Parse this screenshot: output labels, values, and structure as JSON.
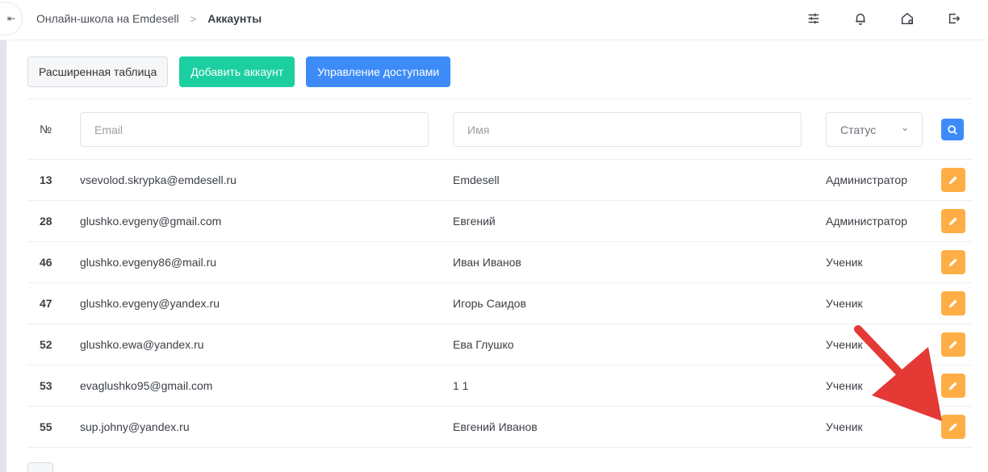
{
  "header": {
    "collapse_glyph": "⇤",
    "breadcrumb": {
      "root": "Онлайн-школа на Emdesell",
      "separator": ">",
      "current": "Аккаунты"
    },
    "icons": [
      "sliders-icon",
      "bell-icon",
      "home-settings-icon",
      "logout-icon"
    ]
  },
  "toolbar": {
    "extended_table_label": "Расширенная таблица",
    "add_account_label": "Добавить аккаунт",
    "access_management_label": "Управление доступами"
  },
  "filters": {
    "num_header": "№",
    "email_placeholder": "Email",
    "name_placeholder": "Имя",
    "status_label": "Статус",
    "status_chevron": "⌄"
  },
  "rows": [
    {
      "id": "13",
      "email": "vsevolod.skrypka@emdesell.ru",
      "name": "Emdesell",
      "status": "Администратор"
    },
    {
      "id": "28",
      "email": "glushko.evgeny@gmail.com",
      "name": "Евгений",
      "status": "Администратор"
    },
    {
      "id": "46",
      "email": "glushko.evgeny86@mail.ru",
      "name": "Иван Иванов",
      "status": "Ученик"
    },
    {
      "id": "47",
      "email": "glushko.evgeny@yandex.ru",
      "name": "Игорь Саидов",
      "status": "Ученик"
    },
    {
      "id": "52",
      "email": "glushko.ewa@yandex.ru",
      "name": "Ева Глушко",
      "status": "Ученик"
    },
    {
      "id": "53",
      "email": "evaglushko95@gmail.com",
      "name": "1 1",
      "status": "Ученик"
    },
    {
      "id": "55",
      "email": "sup.johny@yandex.ru",
      "name": "Евгений Иванов",
      "status": "Ученик"
    }
  ],
  "colors": {
    "add_button": "#1ccfa0",
    "primary_button": "#3d8bf7",
    "edit_button": "#ffae45",
    "annotation_arrow": "#e53935"
  }
}
